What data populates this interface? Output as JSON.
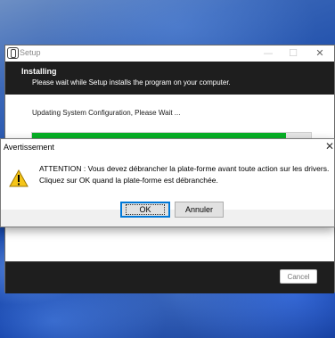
{
  "setup_window": {
    "title": "Setup",
    "controls": {
      "minimize": "—",
      "maximize": "☐",
      "close": "✕"
    },
    "header": {
      "heading": "Installing",
      "subheading": "Please wait while Setup installs the program on your computer."
    },
    "status_text": "Updating System Configuration, Please Wait ...",
    "progress": 0.91,
    "progress_color": "#06b025",
    "cancel_label": "Cancel"
  },
  "alert": {
    "title": "Avertissement",
    "close": "✕",
    "icon": "warning-icon",
    "message_line1": "ATTENTION : Vous devez débrancher la plate-forme avant toute action sur les drivers.",
    "message_line2": "Cliquez sur OK quand la plate-forme est débranchée.",
    "ok_label": "OK",
    "cancel_label": "Annuler"
  }
}
